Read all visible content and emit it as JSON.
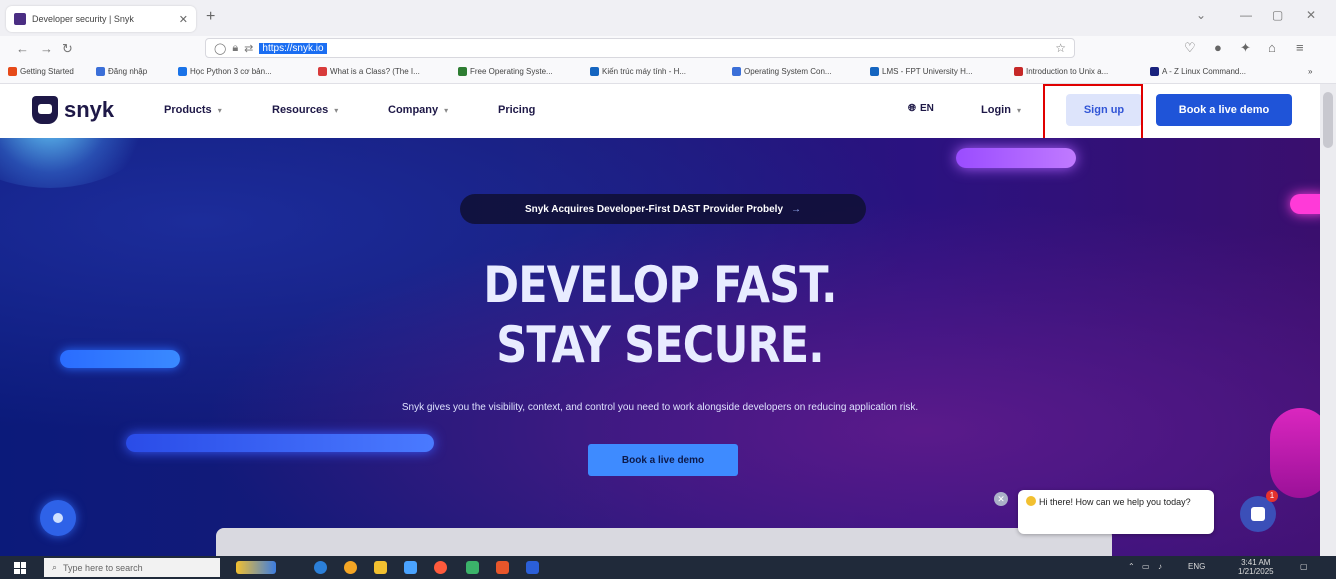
{
  "browser": {
    "tab_title": "Developer security | Snyk",
    "url": "https://snyk.io",
    "bookmarks": [
      "Getting Started",
      "Đăng nhập",
      "Học Python 3 cơ bản...",
      "What is a Class? (The I...",
      "Free Operating Syste...",
      "Kiến trúc máy tính - H...",
      "Operating System Con...",
      "LMS - FPT University H...",
      "Introduction to Unix a...",
      "A - Z Linux Command..."
    ],
    "bookmark_colors": [
      "#e64a19",
      "#3b6fd8",
      "#1a73e8",
      "#d83b3b",
      "#2e7d32",
      "#1565c0",
      "#3b6fd8",
      "#1565c0",
      "#c62828",
      "#1a237e"
    ]
  },
  "header": {
    "logo_text": "snyk",
    "nav": [
      "Products",
      "Resources",
      "Company",
      "Pricing"
    ],
    "lang": "EN",
    "login": "Login",
    "signup": "Sign up",
    "book_demo": "Book a live demo"
  },
  "hero": {
    "announcement": "Snyk Acquires Developer-First DAST Provider Probely",
    "headline_1": "DEVELOP FAST.",
    "headline_2": "STAY SECURE.",
    "subtext": "Snyk gives you the visibility, context, and control you need to work alongside developers on reducing application risk.",
    "cta": "Book a live demo"
  },
  "chat": {
    "message": "Hi there! How can we help you today?",
    "badge": "1"
  },
  "taskbar": {
    "search_placeholder": "Type here to search",
    "time": "3:41 AM",
    "date": "1/21/2025",
    "lang": "ENG"
  },
  "colors": {
    "brand_dark": "#1e1847",
    "primary": "#1f54d8",
    "signup_bg": "#dde4fb",
    "highlight": "#e00000"
  }
}
